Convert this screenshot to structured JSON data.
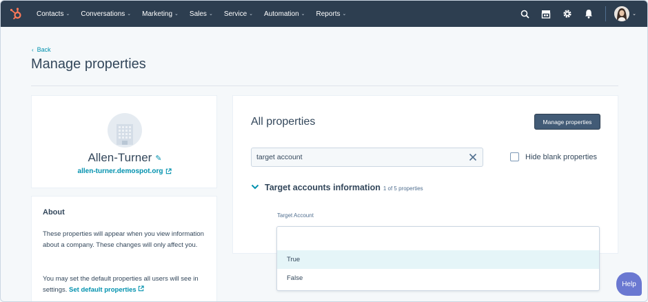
{
  "nav": {
    "items": [
      {
        "label": "Contacts"
      },
      {
        "label": "Conversations"
      },
      {
        "label": "Marketing"
      },
      {
        "label": "Sales"
      },
      {
        "label": "Service"
      },
      {
        "label": "Automation"
      },
      {
        "label": "Reports"
      }
    ],
    "icons": [
      "search-icon",
      "marketplace-icon",
      "settings-icon",
      "notifications-icon"
    ]
  },
  "header": {
    "back_label": "Back",
    "title": "Manage properties"
  },
  "company": {
    "name": "Allen-Turner",
    "domain": "allen-turner.demospot.org"
  },
  "about": {
    "title": "About",
    "text1": "These properties will appear when you view information about a company. These changes will only affect you.",
    "text2_prefix": "You may set the default properties all users will see in settings.",
    "text2_link": "Set default properties"
  },
  "properties": {
    "title": "All properties",
    "manage_button": "Manage properties",
    "search_value": "target account",
    "hide_blank_label": "Hide blank properties",
    "hide_blank_checked": false,
    "section_title": "Target accounts information",
    "section_count": "1 of 5 properties",
    "field_label": "Target Account"
  },
  "dropdown": {
    "options": [
      {
        "label": "True",
        "highlighted": true
      },
      {
        "label": "False",
        "highlighted": false
      }
    ]
  },
  "help": {
    "label": "Help"
  },
  "colors": {
    "nav_bg": "#2d3e50",
    "link": "#0091ae",
    "primary_button": "#425b76",
    "help_bubble": "#6a78d1",
    "highlight": "#e5f5f8"
  }
}
